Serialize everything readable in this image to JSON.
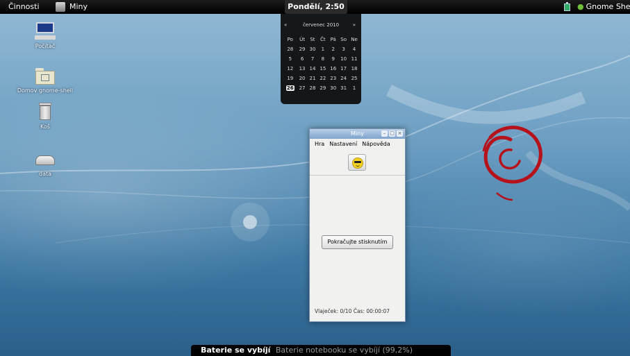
{
  "panel": {
    "activities": "Činnosti",
    "app_name": "Miny",
    "clock": "Pondělí, 2:50",
    "user": "Gnome Shell"
  },
  "calendar": {
    "prev": "«",
    "month": "červenec 2010",
    "next": "»",
    "weekdays": [
      "Po",
      "Út",
      "St",
      "Čt",
      "Pá",
      "So",
      "Ne"
    ],
    "weeks": [
      [
        "28",
        "29",
        "30",
        "1",
        "2",
        "3",
        "4"
      ],
      [
        "5",
        "6",
        "7",
        "8",
        "9",
        "10",
        "11"
      ],
      [
        "12",
        "13",
        "14",
        "15",
        "16",
        "17",
        "18"
      ],
      [
        "19",
        "20",
        "21",
        "22",
        "23",
        "24",
        "25"
      ],
      [
        "26",
        "27",
        "28",
        "29",
        "30",
        "31",
        "1"
      ]
    ],
    "today": "26"
  },
  "desktop_icons": [
    {
      "label": "Počítač",
      "icon": "computer-icon"
    },
    {
      "label": "Domov gnome-shell",
      "icon": "home-folder-icon"
    },
    {
      "label": "Koš",
      "icon": "trash-icon"
    },
    {
      "label": "data",
      "icon": "drive-icon"
    }
  ],
  "mines_window": {
    "title": "Miny",
    "menu": [
      "Hra",
      "Nastavení",
      "Nápověda"
    ],
    "continue_button": "Pokračujte stisknutím",
    "status": "Vlaječek: 0/10  Čas: 00:00:07"
  },
  "notification": {
    "title": "Baterie se vybíjí",
    "body": "Baterie notebooku se vybíjí (99,2%)"
  },
  "colors": {
    "panel": "#000000",
    "swirl": "#b5121b",
    "titlebar": "#7fa3cc"
  }
}
